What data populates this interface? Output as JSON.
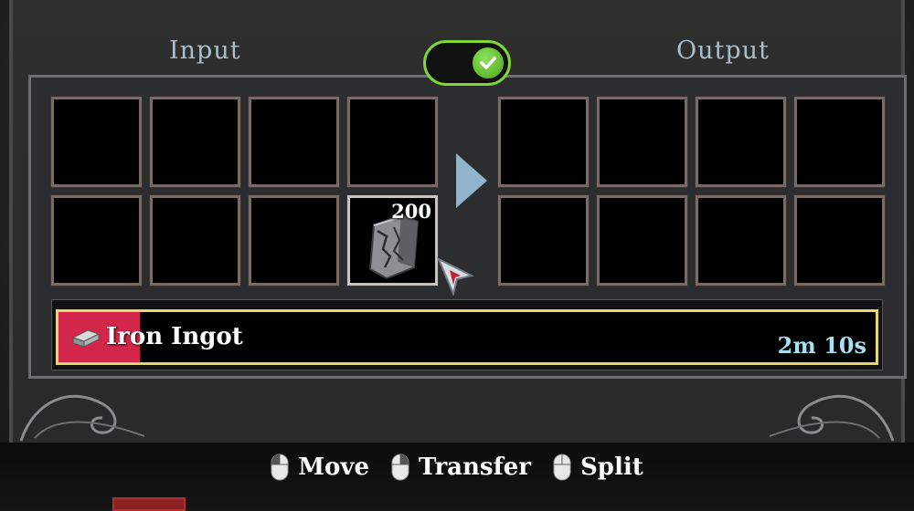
{
  "header": {
    "input_label": "Input",
    "output_label": "Output",
    "toggle_on": true
  },
  "input_slots": [
    {
      "item": null
    },
    {
      "item": null
    },
    {
      "item": null
    },
    {
      "item": null
    },
    {
      "item": null
    },
    {
      "item": null
    },
    {
      "item": null
    },
    {
      "item": "iron-ore-icon",
      "count": "200"
    }
  ],
  "output_slots": [
    {
      "item": null
    },
    {
      "item": null
    },
    {
      "item": null
    },
    {
      "item": null
    },
    {
      "item": null
    },
    {
      "item": null
    },
    {
      "item": null
    },
    {
      "item": null
    }
  ],
  "progress": {
    "label": "Iron Ingot",
    "time_remaining": "2m 10s",
    "fraction": 0.1,
    "fill_color": "#d4264a",
    "border_color": "#e6d66d"
  },
  "hints": [
    {
      "icon": "mouse-left-icon",
      "label": "Move"
    },
    {
      "icon": "mouse-right-icon",
      "label": "Transfer"
    },
    {
      "icon": "mouse-icon",
      "label": "Split"
    }
  ],
  "colors": {
    "toggle_accent": "#7fd636",
    "arrow": "#8fb4cc",
    "label_text": "#a9bfcc"
  }
}
